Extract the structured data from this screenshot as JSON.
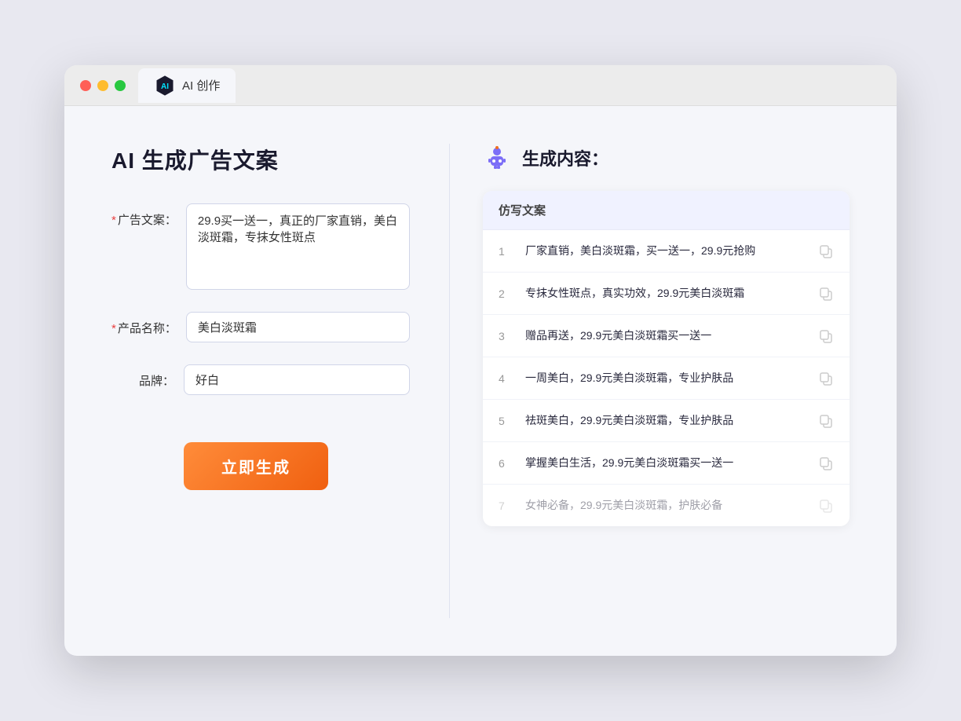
{
  "window": {
    "tab_label": "AI 创作"
  },
  "left": {
    "title": "AI 生成广告文案",
    "form": {
      "ad_copy_label": "广告文案：",
      "ad_copy_required": true,
      "ad_copy_value": "29.9买一送一，真正的厂家直销，美白淡斑霜，专抹女性斑点",
      "product_name_label": "产品名称：",
      "product_name_required": true,
      "product_name_value": "美白淡斑霜",
      "brand_label": "品牌：",
      "brand_required": false,
      "brand_value": "好白"
    },
    "generate_button": "立即生成"
  },
  "right": {
    "title": "生成内容：",
    "table_header": "仿写文案",
    "results": [
      {
        "num": "1",
        "text": "厂家直销，美白淡斑霜，买一送一，29.9元抢购",
        "faded": false
      },
      {
        "num": "2",
        "text": "专抹女性斑点，真实功效，29.9元美白淡斑霜",
        "faded": false
      },
      {
        "num": "3",
        "text": "赠品再送，29.9元美白淡斑霜买一送一",
        "faded": false
      },
      {
        "num": "4",
        "text": "一周美白，29.9元美白淡斑霜，专业护肤品",
        "faded": false
      },
      {
        "num": "5",
        "text": "祛斑美白，29.9元美白淡斑霜，专业护肤品",
        "faded": false
      },
      {
        "num": "6",
        "text": "掌握美白生活，29.9元美白淡斑霜买一送一",
        "faded": false
      },
      {
        "num": "7",
        "text": "女神必备，29.9元美白淡斑霜，护肤必备",
        "faded": true
      }
    ]
  },
  "colors": {
    "accent_orange": "#f07020",
    "required_red": "#e84040",
    "brand_purple": "#7c6ef7"
  }
}
